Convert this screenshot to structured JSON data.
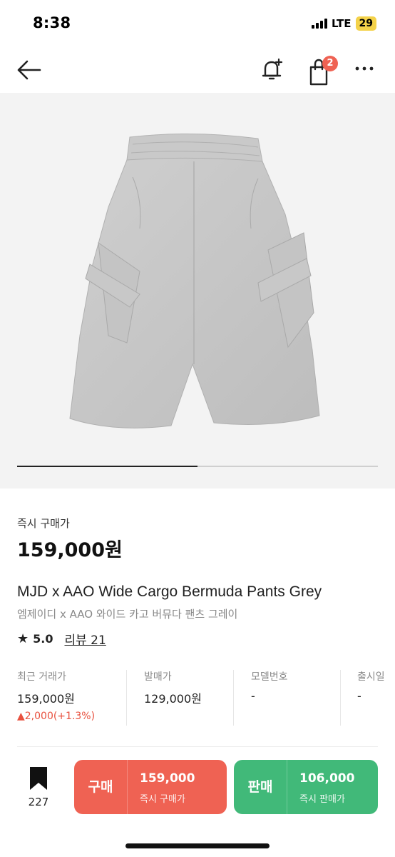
{
  "status_bar": {
    "time": "8:38",
    "network": "LTE",
    "battery": "29"
  },
  "header": {
    "cart_badge": "2",
    "icons": [
      "arrow-left-icon",
      "bell-plus-icon",
      "shopping-bag-icon",
      "more-horizontal-icon"
    ]
  },
  "gallery": {
    "progress": 0.5
  },
  "price": {
    "label": "즉시 구매가",
    "value": "159,000원"
  },
  "product": {
    "name_en": "MJD x AAO Wide Cargo Bermuda Pants Grey",
    "name_ko": "엠제이디 x AAO 와이드 카고 버뮤다 팬츠 그레이",
    "rating": "5.0",
    "reviews": "리뷰 21"
  },
  "info": {
    "recent_trade": {
      "label": "최근 거래가",
      "value": "159,000원",
      "change": "▲2,000(+1.3%)"
    },
    "release_price": {
      "label": "발매가",
      "value": "129,000원"
    },
    "model_no": {
      "label": "모델번호",
      "value": "-"
    },
    "release_date": {
      "label": "출시일",
      "value": "-"
    }
  },
  "bottom_bar": {
    "bookmark_count": "227",
    "buy": {
      "label": "구매",
      "price": "159,000",
      "sub": "즉시 구매가"
    },
    "sell": {
      "label": "판매",
      "price": "106,000",
      "sub": "즉시 판매가"
    }
  },
  "colors": {
    "buy": "#ef6253",
    "sell": "#41b979",
    "badge": "#ef6253",
    "change_up": "#e8513f"
  }
}
